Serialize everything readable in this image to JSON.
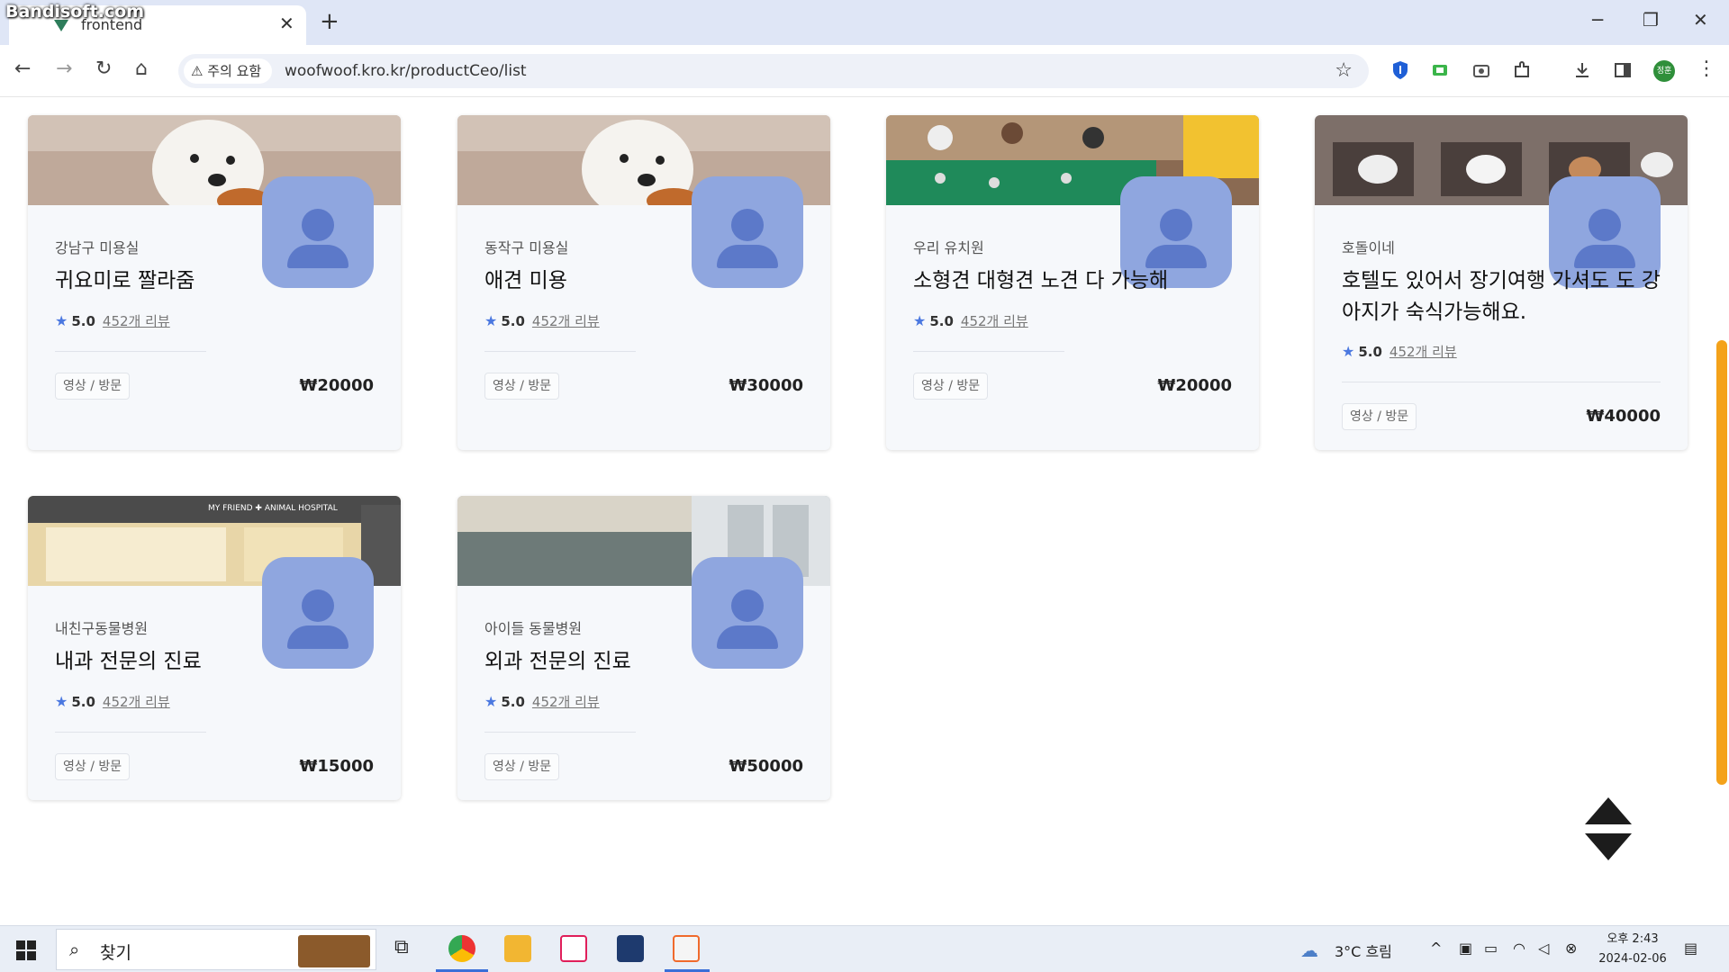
{
  "watermark": "Bandisoft.com",
  "browser": {
    "tab_title": "frontend",
    "tab_close": "✕",
    "new_tab": "+",
    "security_warning": "주의 요함",
    "url": "woofwoof.kro.kr/productCeo/list",
    "profile_initials": "정훈"
  },
  "cards": [
    {
      "category": "강남구 미용실",
      "name": "귀요미로 짤라줌",
      "rating": "5.0",
      "reviews": "452개 리뷰",
      "badge": "영상 / 방문",
      "price": "₩20000"
    },
    {
      "category": "동작구 미용실",
      "name": "애견 미용",
      "rating": "5.0",
      "reviews": "452개 리뷰",
      "badge": "영상 / 방문",
      "price": "₩30000"
    },
    {
      "category": "우리 유치원",
      "name": "소형견 대형견 노견 다 가능해",
      "rating": "5.0",
      "reviews": "452개 리뷰",
      "badge": "영상 / 방문",
      "price": "₩20000"
    },
    {
      "category": "호돌이네",
      "name": "호텔도 있어서 장기여행 가셔도 도 강아지가 숙식가능해요.",
      "rating": "5.0",
      "reviews": "452개 리뷰",
      "badge": "영상 / 방문",
      "price": "₩40000"
    },
    {
      "category": "내친구동물병원",
      "name": "내과 전문의 진료",
      "rating": "5.0",
      "reviews": "452개 리뷰",
      "badge": "영상 / 방문",
      "price": "₩15000",
      "photo_sign": "MY FRIEND ✚ ANIMAL HOSPITAL"
    },
    {
      "category": "아이들 동물병원",
      "name": "외과 전문의 진료",
      "rating": "5.0",
      "reviews": "452개 리뷰",
      "badge": "영상 / 방문",
      "price": "₩50000"
    }
  ],
  "taskbar": {
    "search_label": "찾기",
    "weather": "3°C 흐림",
    "time": "오후 2:43",
    "date": "2024-02-06"
  },
  "colors": {
    "accent": "#4b78e0",
    "profile_placeholder": "#8fa6df",
    "scrollbar": "#f4a21a"
  }
}
